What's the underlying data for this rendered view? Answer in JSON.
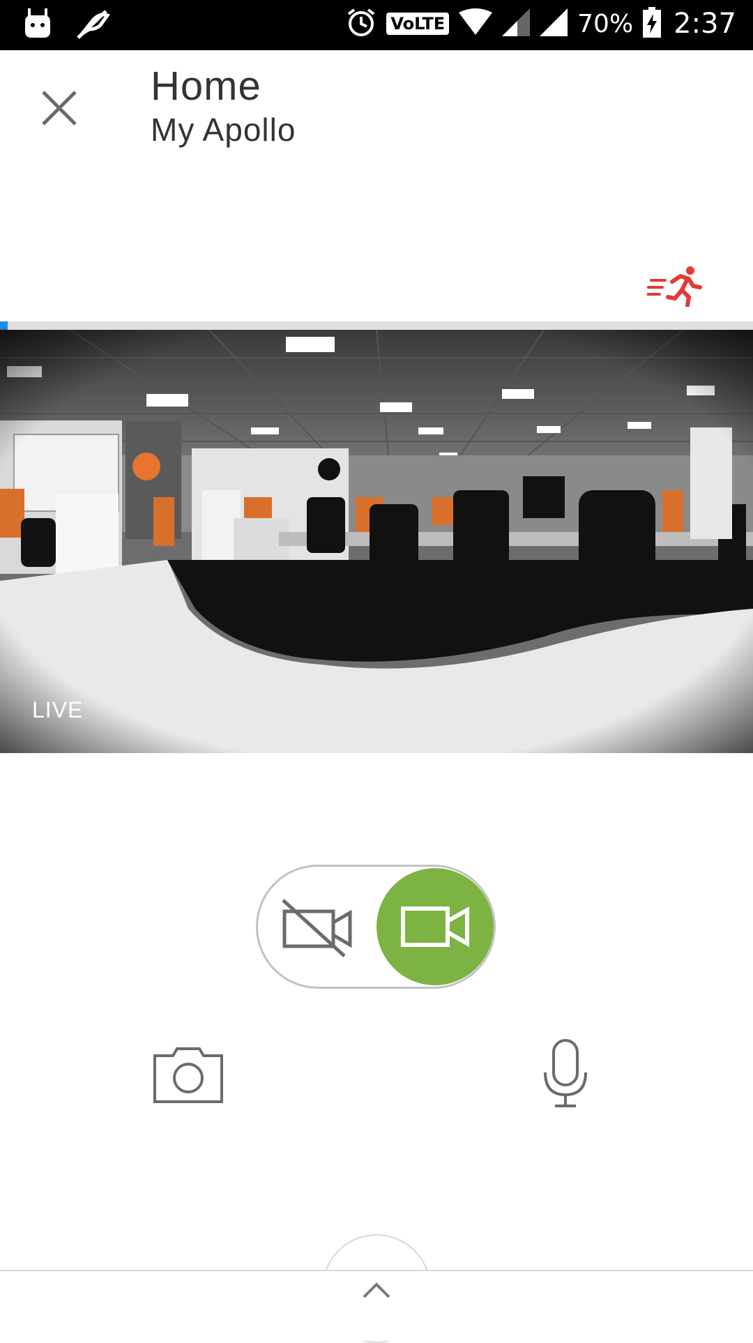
{
  "status_bar": {
    "battery": "70%",
    "time": "2:37",
    "network_badge": "VoLTE",
    "icons": [
      "notification-icon",
      "mute-icon",
      "alarm-icon",
      "volte-icon",
      "wifi-icon",
      "signal-icon",
      "signal-icon",
      "battery-charging-icon"
    ]
  },
  "header": {
    "title": "Home",
    "subtitle": "My Apollo",
    "close_icon": "close-icon"
  },
  "motion": {
    "icon": "motion-running-icon",
    "color": "#e53935"
  },
  "timeline": {
    "progress": 0.01,
    "fill_color": "#1e88e5"
  },
  "video": {
    "live_label": "LIVE"
  },
  "controls": {
    "mode_toggle": {
      "off_icon": "video-off-icon",
      "on_icon": "video-icon",
      "on_color": "#7cb342"
    },
    "snapshot_icon": "camera-icon",
    "talk_icon": "microphone-icon"
  },
  "drawer": {
    "icon": "chevron-up-icon"
  }
}
